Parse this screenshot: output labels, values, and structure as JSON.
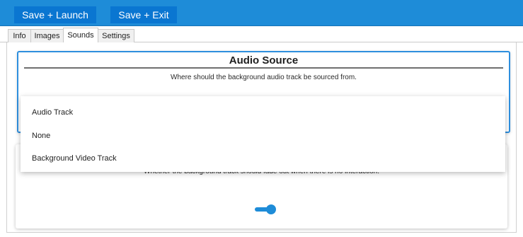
{
  "toolbar": {
    "save_launch_label": "Save + Launch",
    "save_exit_label": "Save + Exit"
  },
  "tabs": [
    {
      "label": "Info"
    },
    {
      "label": "Images"
    },
    {
      "label": "Sounds",
      "active": true
    },
    {
      "label": "Settings"
    }
  ],
  "audio_source": {
    "title": "Audio Source",
    "description": "Where should the background audio track be sourced from.",
    "dropdown_options": [
      "Audio Track",
      "None",
      "Background Video Track"
    ]
  },
  "fade": {
    "description": "Whether the background track should fade out when there is no interaction.",
    "toggle_on": true
  },
  "colors": {
    "accent": "#1e8cd8",
    "toolbar_button": "#0a76d1",
    "card_border": "#2e8fde"
  }
}
